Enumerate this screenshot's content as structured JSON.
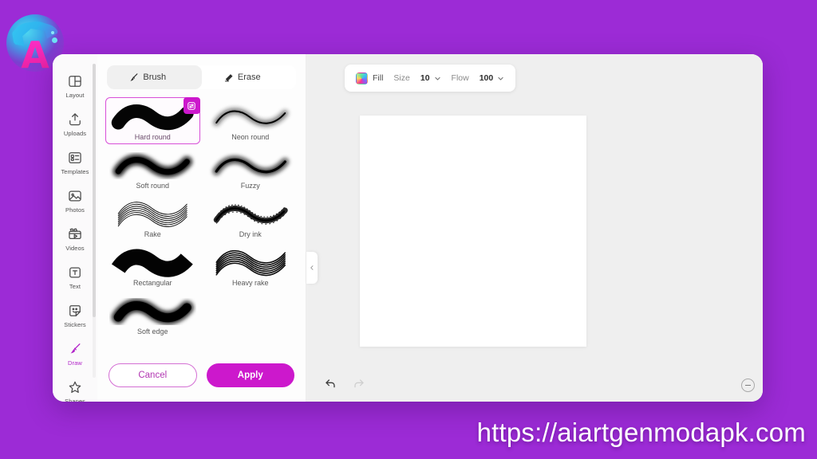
{
  "watermark": "https://aiartgenmodapk.com",
  "logo": {
    "letter": "A",
    "name": "app-logo"
  },
  "theme": {
    "background_purple": "#9c2bd6",
    "accent_magenta": "#cc18cc",
    "accent_purple": "#b224c9",
    "panel_bg": "#fdfdfd",
    "workspace_bg": "#efefef",
    "canvas_bg": "#ffffff"
  },
  "sidebar": {
    "items": [
      {
        "label": "Layout",
        "icon": "layout-icon",
        "active": false
      },
      {
        "label": "Uploads",
        "icon": "upload-icon",
        "active": false
      },
      {
        "label": "Templates",
        "icon": "templates-icon",
        "active": false
      },
      {
        "label": "Photos",
        "icon": "photos-icon",
        "active": false
      },
      {
        "label": "Videos",
        "icon": "videos-icon",
        "active": false
      },
      {
        "label": "Text",
        "icon": "text-icon",
        "active": false
      },
      {
        "label": "Stickers",
        "icon": "stickers-icon",
        "active": false
      },
      {
        "label": "Draw",
        "icon": "brush-icon",
        "active": true
      },
      {
        "label": "Shapes",
        "icon": "star-icon",
        "active": false
      }
    ]
  },
  "panel": {
    "tabs": [
      {
        "label": "Brush",
        "icon": "paintbrush-icon",
        "active": true
      },
      {
        "label": "Erase",
        "icon": "eraser-icon",
        "active": false
      }
    ],
    "brushes": [
      {
        "name": "Hard round",
        "style": "hard",
        "selected": true
      },
      {
        "name": "Neon round",
        "style": "neon",
        "selected": false
      },
      {
        "name": "Soft round",
        "style": "soft",
        "selected": false
      },
      {
        "name": "Fuzzy",
        "style": "fuzzy",
        "selected": false
      },
      {
        "name": "Rake",
        "style": "rake",
        "selected": false
      },
      {
        "name": "Dry ink",
        "style": "dryink",
        "selected": false
      },
      {
        "name": "Rectangular",
        "style": "rectangular",
        "selected": false
      },
      {
        "name": "Heavy rake",
        "style": "heavyrake",
        "selected": false
      },
      {
        "name": "Soft edge",
        "style": "softedge",
        "selected": false
      }
    ],
    "badge_icon": "brush-settings-icon",
    "cancel_label": "Cancel",
    "apply_label": "Apply",
    "collapse_icon": "chevron-left-icon"
  },
  "toolbar": {
    "fill_label": "Fill",
    "fill_swatch_icon": "color-swatch-icon",
    "size_label": "Size",
    "size_value": "10",
    "flow_label": "Flow",
    "flow_value": "100",
    "chevron_icon": "chevron-down-icon"
  },
  "workspace": {
    "undo_icon": "undo-icon",
    "redo_icon": "redo-icon",
    "zoom_out_icon": "zoom-out-icon"
  }
}
